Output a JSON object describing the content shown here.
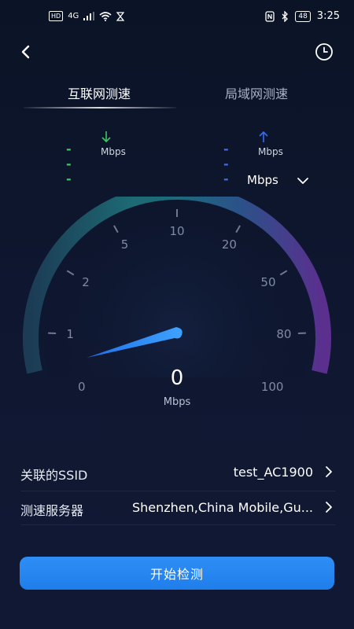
{
  "status_bar": {
    "left": {
      "hd": "HD",
      "signal": "4G",
      "wifi_icon": "wifi-icon",
      "hourglass_icon": "hourglass-icon"
    },
    "right": {
      "nfc_icon": "nfc-icon",
      "bluetooth_icon": "bluetooth-icon",
      "battery": "48",
      "time": "3:25"
    }
  },
  "header": {
    "back_icon": "chevron-left-icon",
    "history_icon": "clock-icon"
  },
  "tabs": [
    {
      "label": "互联网测速",
      "active": true
    },
    {
      "label": "局域网测速",
      "active": false
    }
  ],
  "rates": {
    "download": {
      "value": "---",
      "unit": "Mbps",
      "color": "#39c860"
    },
    "upload": {
      "value": "---",
      "unit": "Mbps",
      "color": "#3a6cf0"
    }
  },
  "unit_select": {
    "value": "Mbps"
  },
  "gauge": {
    "labels": [
      "0",
      "1",
      "2",
      "5",
      "10",
      "20",
      "50",
      "80",
      "100"
    ],
    "value": "0",
    "unit": "Mbps"
  },
  "info": {
    "ssid": {
      "label": "关联的SSID",
      "value": "test_AC1900"
    },
    "server": {
      "label": "测速服务器",
      "value": "Shenzhen,China Mobile,Gu..."
    }
  },
  "start_button": {
    "label": "开始检测",
    "color": "#2a88f2"
  }
}
